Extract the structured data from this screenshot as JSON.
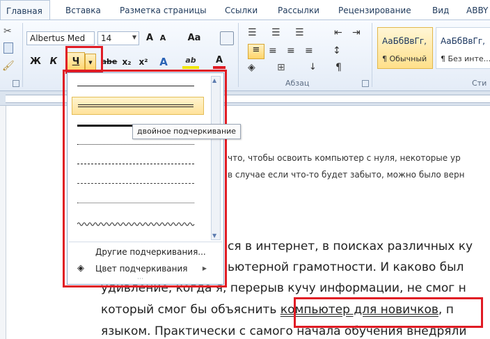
{
  "tabs": [
    "Главная",
    "Вставка",
    "Разметка страницы",
    "Ссылки",
    "Рассылки",
    "Рецензирование",
    "Вид",
    "ABBY"
  ],
  "font": {
    "name": "Albertus Med",
    "size": "14",
    "grow": "A",
    "shrink": "A",
    "case_label": "Aa"
  },
  "format_buttons": {
    "bold": "Ж",
    "italic": "К",
    "underline": "Ч",
    "strike": "abe",
    "subscript": "x₂",
    "superscript": "x²",
    "highlight_label": "ab",
    "font_color_label": "A"
  },
  "groups": {
    "paragraph": "Абзац",
    "styles_partial": "Сти"
  },
  "styles": [
    {
      "preview": "АаБбВвГг,",
      "name": "¶ Обычный"
    },
    {
      "preview": "АаБбВвГг,",
      "name": "¶ Без инте..."
    }
  ],
  "underline_menu": {
    "line_styles": [
      "single",
      "double",
      "thick",
      "dotted",
      "dashed",
      "dash-dot",
      "dash-dot-dot",
      "wavy"
    ],
    "tooltip": "двойное подчеркивание",
    "more": "Другие подчеркивания...",
    "color": "Цвет подчеркивания"
  },
  "document": {
    "line1": "что, чтобы освоить компьютер с нуля, некоторые ур",
    "line2": "в случае если что-то будет забыто, можно было верн",
    "p1": "ся в интернет, в поисках различных ку",
    "p2": "ьютерной грамотности. И каково был",
    "p3": "удивление, когда я, перерыв кучу информации, не смог н",
    "p4_before": "который смог бы объяснить ",
    "p4_link": "компьютер для новичков",
    "p4_after": ", п",
    "p5": "языком. Практически с самого начала обучения внедряли"
  },
  "colors": {
    "highlight": "#f2e600",
    "font_color": "#e01b24",
    "annotation": "#e01b24"
  }
}
